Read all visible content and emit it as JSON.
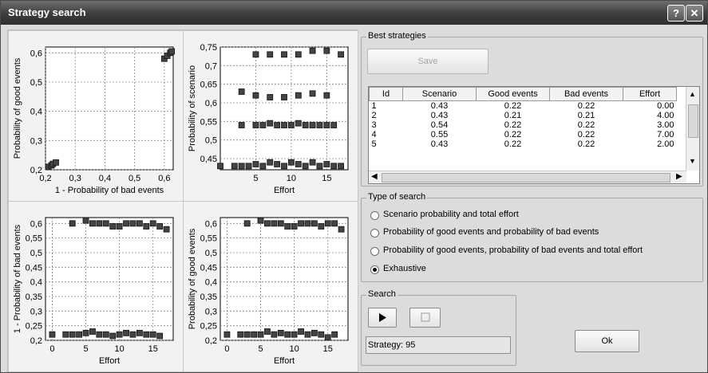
{
  "window": {
    "title": "Strategy search",
    "help_button": "?",
    "close_button": "✕"
  },
  "best_strategies": {
    "group_title": "Best strategies",
    "save_label": "Save",
    "columns": [
      "Id",
      "Scenario",
      "Good events",
      "Bad events",
      "Effort"
    ],
    "rows": [
      [
        "1",
        "0.43",
        "0.22",
        "0.22",
        "0.00"
      ],
      [
        "2",
        "0.43",
        "0.21",
        "0.21",
        "4.00"
      ],
      [
        "3",
        "0.54",
        "0.22",
        "0.22",
        "3.00"
      ],
      [
        "4",
        "0.55",
        "0.22",
        "0.22",
        "7.00"
      ],
      [
        "5",
        "0.43",
        "0.22",
        "0.22",
        "2.00"
      ]
    ]
  },
  "type_of_search": {
    "group_title": "Type of search",
    "options": [
      "Scenario probability and total effort",
      "Probability of good  events and probability of bad events",
      "Probability of good  events, probability of bad events and total effort",
      "Exhaustive"
    ],
    "selected_index": 3
  },
  "search": {
    "group_title": "Search",
    "status_text": "Strategy: 95"
  },
  "ok_label": "Ok",
  "chart_data": [
    {
      "type": "scatter",
      "xlabel": "1 - Probability of bad events",
      "ylabel": "Probability of good events",
      "xlim": [
        0.2,
        0.63
      ],
      "ylim": [
        0.2,
        0.62
      ],
      "xticks": [
        "0,2",
        "0,3",
        "0,4",
        "0,5",
        "0,6"
      ],
      "yticks": [
        "0,2",
        "0,3",
        "0,4",
        "0,5",
        "0,6"
      ],
      "points": [
        [
          0.21,
          0.21
        ],
        [
          0.22,
          0.215
        ],
        [
          0.225,
          0.22
        ],
        [
          0.235,
          0.225
        ],
        [
          0.6,
          0.58
        ],
        [
          0.61,
          0.59
        ],
        [
          0.62,
          0.6
        ],
        [
          0.625,
          0.605
        ]
      ]
    },
    {
      "type": "scatter",
      "xlabel": "Effort",
      "ylabel": "Probability of scenario",
      "xlim": [
        0,
        18
      ],
      "ylim": [
        0.42,
        0.75
      ],
      "xticks": [
        "5",
        "10",
        "15"
      ],
      "yticks": [
        "0,45",
        "0,5",
        "0,55",
        "0,6",
        "0,65",
        "0,7",
        "0,75"
      ],
      "points": [
        [
          0,
          0.43
        ],
        [
          2,
          0.43
        ],
        [
          3,
          0.43
        ],
        [
          4,
          0.43
        ],
        [
          5,
          0.435
        ],
        [
          6,
          0.43
        ],
        [
          7,
          0.44
        ],
        [
          8,
          0.435
        ],
        [
          9,
          0.43
        ],
        [
          10,
          0.44
        ],
        [
          11,
          0.435
        ],
        [
          12,
          0.43
        ],
        [
          13,
          0.44
        ],
        [
          14,
          0.43
        ],
        [
          15,
          0.435
        ],
        [
          16,
          0.43
        ],
        [
          17,
          0.43
        ],
        [
          3,
          0.54
        ],
        [
          5,
          0.54
        ],
        [
          6,
          0.54
        ],
        [
          7,
          0.545
        ],
        [
          8,
          0.54
        ],
        [
          9,
          0.54
        ],
        [
          10,
          0.54
        ],
        [
          11,
          0.545
        ],
        [
          12,
          0.54
        ],
        [
          13,
          0.54
        ],
        [
          14,
          0.54
        ],
        [
          15,
          0.54
        ],
        [
          16,
          0.54
        ],
        [
          3,
          0.63
        ],
        [
          5,
          0.62
        ],
        [
          7,
          0.615
        ],
        [
          9,
          0.615
        ],
        [
          11,
          0.62
        ],
        [
          13,
          0.625
        ],
        [
          15,
          0.62
        ],
        [
          5,
          0.73
        ],
        [
          7,
          0.73
        ],
        [
          9,
          0.73
        ],
        [
          11,
          0.73
        ],
        [
          13,
          0.74
        ],
        [
          15,
          0.74
        ],
        [
          17,
          0.73
        ]
      ]
    },
    {
      "type": "scatter",
      "xlabel": "Effort",
      "ylabel": "1 - Probability of bad events",
      "xlim": [
        -1,
        18
      ],
      "ylim": [
        0.2,
        0.62
      ],
      "xticks": [
        "0",
        "5",
        "10",
        "15"
      ],
      "yticks": [
        "0,2",
        "0,25",
        "0,3",
        "0,35",
        "0,4",
        "0,45",
        "0,5",
        "0,55",
        "0,6"
      ],
      "points": [
        [
          0,
          0.22
        ],
        [
          2,
          0.22
        ],
        [
          3,
          0.22
        ],
        [
          4,
          0.22
        ],
        [
          5,
          0.225
        ],
        [
          6,
          0.23
        ],
        [
          7,
          0.22
        ],
        [
          8,
          0.22
        ],
        [
          9,
          0.215
        ],
        [
          10,
          0.22
        ],
        [
          11,
          0.225
        ],
        [
          12,
          0.22
        ],
        [
          13,
          0.225
        ],
        [
          14,
          0.22
        ],
        [
          15,
          0.22
        ],
        [
          16,
          0.215
        ],
        [
          3,
          0.6
        ],
        [
          5,
          0.61
        ],
        [
          6,
          0.6
        ],
        [
          7,
          0.6
        ],
        [
          8,
          0.6
        ],
        [
          9,
          0.59
        ],
        [
          10,
          0.59
        ],
        [
          11,
          0.6
        ],
        [
          12,
          0.6
        ],
        [
          13,
          0.6
        ],
        [
          14,
          0.59
        ],
        [
          15,
          0.6
        ],
        [
          16,
          0.59
        ],
        [
          17,
          0.58
        ]
      ]
    },
    {
      "type": "scatter",
      "xlabel": "Effort",
      "ylabel": "Probability of good events",
      "xlim": [
        -1,
        18
      ],
      "ylim": [
        0.2,
        0.62
      ],
      "xticks": [
        "0",
        "5",
        "10",
        "15"
      ],
      "yticks": [
        "0,2",
        "0,25",
        "0,3",
        "0,35",
        "0,4",
        "0,45",
        "0,5",
        "0,55",
        "0,6"
      ],
      "points": [
        [
          0,
          0.22
        ],
        [
          2,
          0.22
        ],
        [
          3,
          0.22
        ],
        [
          4,
          0.22
        ],
        [
          5,
          0.22
        ],
        [
          6,
          0.23
        ],
        [
          7,
          0.22
        ],
        [
          8,
          0.225
        ],
        [
          9,
          0.22
        ],
        [
          10,
          0.22
        ],
        [
          11,
          0.23
        ],
        [
          12,
          0.22
        ],
        [
          13,
          0.225
        ],
        [
          14,
          0.22
        ],
        [
          15,
          0.21
        ],
        [
          16,
          0.22
        ],
        [
          3,
          0.6
        ],
        [
          5,
          0.61
        ],
        [
          6,
          0.6
        ],
        [
          7,
          0.6
        ],
        [
          8,
          0.6
        ],
        [
          9,
          0.59
        ],
        [
          10,
          0.59
        ],
        [
          11,
          0.6
        ],
        [
          12,
          0.6
        ],
        [
          13,
          0.6
        ],
        [
          14,
          0.59
        ],
        [
          15,
          0.6
        ],
        [
          16,
          0.6
        ],
        [
          17,
          0.58
        ]
      ]
    }
  ]
}
